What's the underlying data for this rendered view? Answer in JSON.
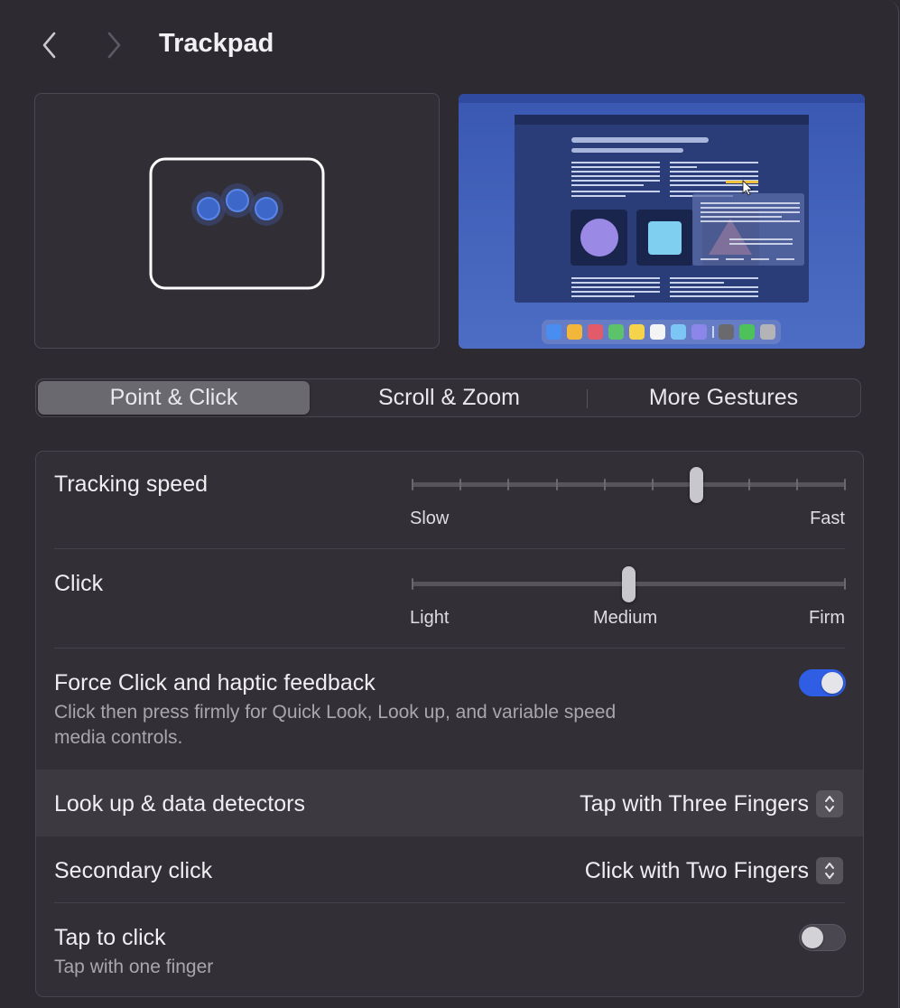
{
  "header": {
    "back_icon": "chevron-left-icon",
    "forward_icon": "chevron-right-icon",
    "title": "Trackpad"
  },
  "tabs": [
    {
      "label": "Point & Click",
      "active": true
    },
    {
      "label": "Scroll & Zoom",
      "active": false
    },
    {
      "label": "More Gestures",
      "active": false
    }
  ],
  "settings": {
    "tracking_speed": {
      "label": "Tracking speed",
      "min_label": "Slow",
      "max_label": "Fast",
      "ticks": 10,
      "value_fraction": 0.66
    },
    "click": {
      "label": "Click",
      "min_label": "Light",
      "mid_label": "Medium",
      "max_label": "Firm",
      "ticks": 3,
      "value_fraction": 0.5
    },
    "force_click": {
      "label": "Force Click and haptic feedback",
      "description_line1": "Click then press firmly for Quick Look, Look up, and variable speed",
      "description_line2": "media controls.",
      "enabled": true
    },
    "look_up": {
      "label": "Look up & data detectors",
      "value": "Tap with Three Fingers"
    },
    "secondary_click": {
      "label": "Secondary click",
      "value": "Click with Two Fingers"
    },
    "tap_to_click": {
      "label": "Tap to click",
      "description": "Tap with one finger",
      "enabled": false
    }
  },
  "colors": {
    "background": "#2d2a31",
    "accent": "#2f5ee5",
    "preview_desktop": "#4a69c0"
  }
}
